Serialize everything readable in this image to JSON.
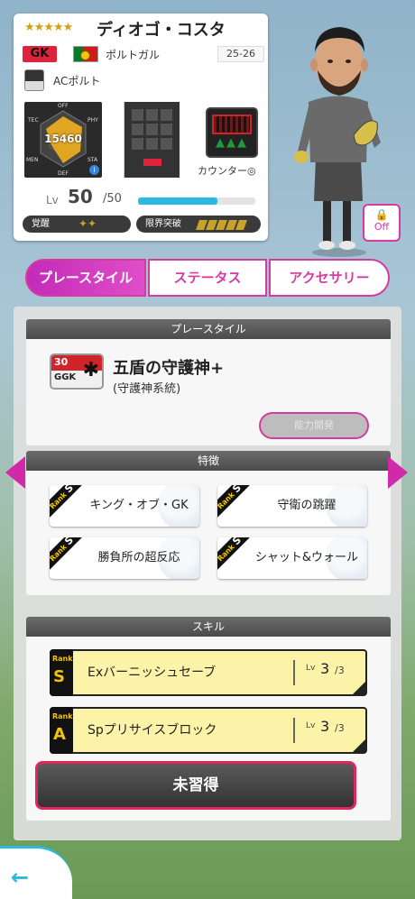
{
  "player": {
    "stars": "★★★★★",
    "name": "ディオゴ・コスタ",
    "position": "GK",
    "nation": "ポルトガル",
    "season": "25-26",
    "club": "ACポルト",
    "radar": {
      "labels": [
        "OFF",
        "PHY",
        "STA",
        "DEF",
        "MEN",
        "TEC"
      ],
      "overall": "15460"
    },
    "tactic": "カウンター◎",
    "level": {
      "label": "Lv",
      "value": "50",
      "max": "/50",
      "progress": 0.68
    },
    "awakening_label": "覚醒",
    "awakening_icons": "✦✦",
    "limit_label": "限界突破",
    "limit_count": 5
  },
  "lock": {
    "icon": "lock-icon",
    "label": "Off"
  },
  "tabs": [
    {
      "label": "プレースタイル",
      "active": true
    },
    {
      "label": "ステータス",
      "active": false
    },
    {
      "label": "アクセサリー",
      "active": false
    }
  ],
  "playstyle": {
    "header": "プレースタイル",
    "icon_num": "30",
    "icon_code": "GGK",
    "name": "五盾の守護神+",
    "sub": "(守護神系統)",
    "ability_button": "能力開発"
  },
  "traits": {
    "header": "特徴",
    "items": [
      {
        "rank": "S",
        "label": "キング・オブ・GK"
      },
      {
        "rank": "S",
        "label": "守衛の跳躍"
      },
      {
        "rank": "S",
        "label": "勝負所の超反応"
      },
      {
        "rank": "S",
        "label": "シャット&ウォール"
      }
    ]
  },
  "skills": {
    "header": "スキル",
    "items": [
      {
        "rank_label": "Rank",
        "rank": "S",
        "name": "Exバーニッシュセーブ",
        "lv_label": "Lv",
        "lv": "3",
        "lv_max": "/3"
      },
      {
        "rank_label": "Rank",
        "rank": "A",
        "name": "Spプリサイスブロック",
        "lv_label": "Lv",
        "lv": "3",
        "lv_max": "/3"
      }
    ],
    "unlearned_button": "未習得"
  },
  "colors": {
    "accent": "#d63ba0",
    "level_bar": "#2ab9e0",
    "rank_gold": "#f5c400"
  }
}
